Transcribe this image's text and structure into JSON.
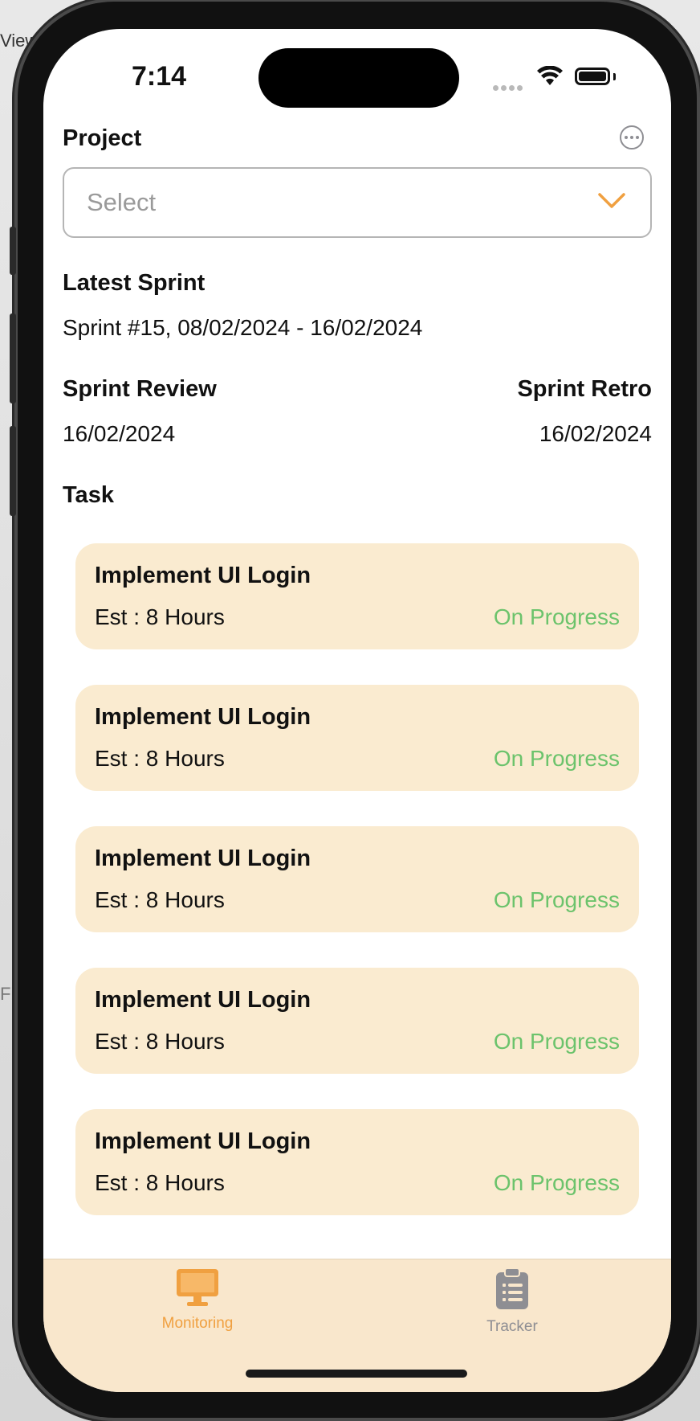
{
  "background": {
    "menu_view": "View",
    "menu_file": "File"
  },
  "status_bar": {
    "time": "7:14"
  },
  "project": {
    "label": "Project",
    "select_placeholder": "Select"
  },
  "latest_sprint": {
    "label": "Latest Sprint",
    "value": "Sprint #15, 08/02/2024 - 16/02/2024"
  },
  "sprint_review": {
    "label": "Sprint Review",
    "date": "16/02/2024"
  },
  "sprint_retro": {
    "label": "Sprint Retro",
    "date": "16/02/2024"
  },
  "task_section": {
    "label": "Task"
  },
  "tasks": [
    {
      "title": "Implement UI Login",
      "estimate": "Est : 8 Hours",
      "status": "On Progress"
    },
    {
      "title": "Implement UI Login",
      "estimate": "Est : 8 Hours",
      "status": "On Progress"
    },
    {
      "title": "Implement UI Login",
      "estimate": "Est : 8 Hours",
      "status": "On Progress"
    },
    {
      "title": "Implement UI Login",
      "estimate": "Est : 8 Hours",
      "status": "On Progress"
    },
    {
      "title": "Implement UI Login",
      "estimate": "Est : 8 Hours",
      "status": "On Progress"
    }
  ],
  "tab_bar": {
    "tabs": [
      {
        "label": "Monitoring",
        "icon": "monitor-icon",
        "active": true
      },
      {
        "label": "Tracker",
        "icon": "clipboard-icon",
        "active": false
      }
    ]
  },
  "colors": {
    "accent": "#f0a040",
    "card_bg": "#faebd0",
    "status_green": "#6cc36c",
    "tab_bar_bg": "#f9e7cc",
    "inactive_tab": "#8e8e93"
  }
}
